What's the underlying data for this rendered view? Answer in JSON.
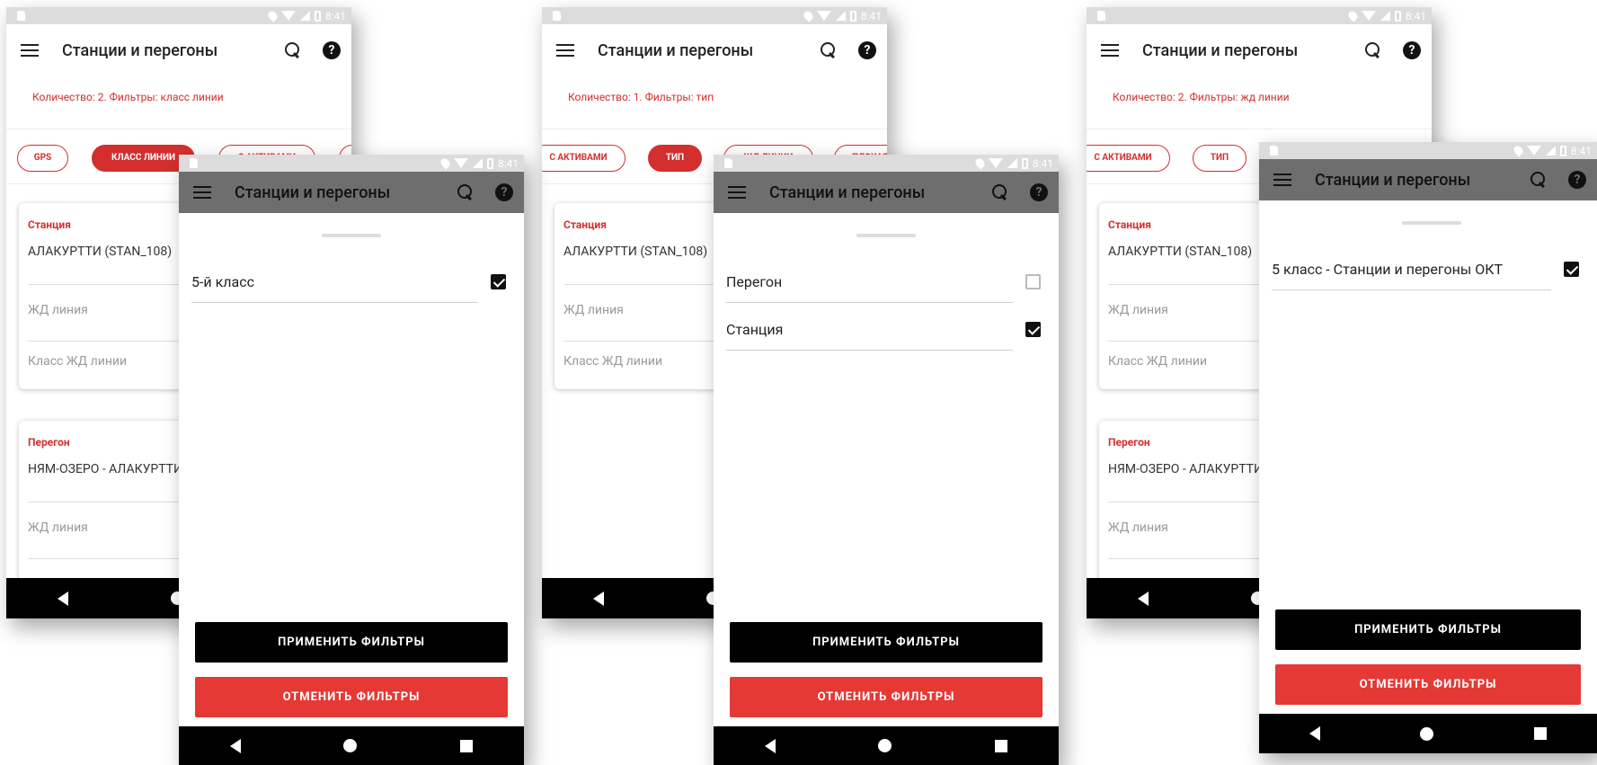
{
  "status_time": "8:41",
  "app_title": "Станции и перегоны",
  "help_symbol": "?",
  "icons": [
    "menu-icon",
    "search-icon",
    "help-icon",
    "back-icon",
    "home-icon",
    "recent-apps-icon",
    "checkbox-icon"
  ],
  "colors": {
    "accent": "#d32f2f",
    "cancel": "#e53935",
    "apply": "#000000"
  },
  "bg_screens": [
    {
      "count_text": "Количество: 2. Фильтры: класс линии",
      "chips": [
        "GPS",
        "КЛАСС ЛИНИИ",
        "С АКТИВАМИ",
        ""
      ]
    },
    {
      "count_text": "Количество: 1. Фильтры: тип",
      "chips": [
        "С АКТИВАМИ",
        "ТИП",
        "ЖД ЛИНИИ",
        "ПЛОХАЯ"
      ]
    },
    {
      "count_text": "Количество: 2. Фильтры: жд линии",
      "chips": [
        "С АКТИВАМИ",
        "ТИП",
        "",
        ""
      ]
    }
  ],
  "cards": [
    {
      "kind": "Станция",
      "name": "АЛАКУРТТИ (STAN_108)",
      "field1": "ЖД линия",
      "field2": "Класс ЖД линии"
    },
    {
      "kind": "Перегон",
      "name": "НЯМ-ОЗЕРО - АЛАКУРТТИ",
      "field1": "ЖД линия"
    }
  ],
  "filter_sheets": [
    {
      "options": [
        {
          "label": "5-й класс",
          "checked": true
        }
      ]
    },
    {
      "options": [
        {
          "label": "Перегон",
          "checked": false
        },
        {
          "label": "Станция",
          "checked": true
        }
      ]
    },
    {
      "options": [
        {
          "label": "5 класс - Станции и перегоны ОКТ",
          "checked": true
        }
      ]
    }
  ],
  "apply_label": "ПРИМЕНИТЬ ФИЛЬТРЫ",
  "cancel_label": "ОТМЕНИТЬ ФИЛЬТРЫ"
}
